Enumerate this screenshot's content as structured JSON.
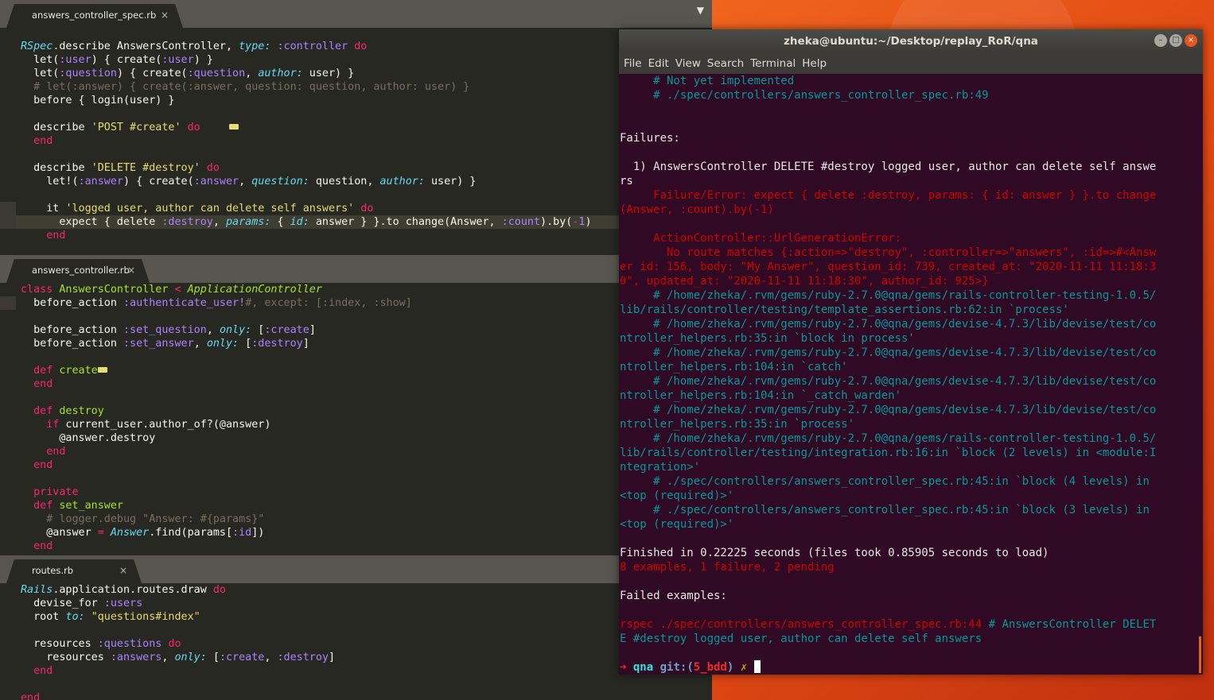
{
  "editor": {
    "pane1": {
      "tab": "answers_controller_spec.rb",
      "close": "×",
      "menu_arrow": "▼",
      "lines": [
        "RSpec.describe AnswersController, type: :controller do",
        "  let(:user) { create(:user) }",
        "  let(:question) { create(:question, author: user) }",
        "  # let(:answer) { create(:answer, question: question, author: user) }",
        "  before { login(user) }",
        "",
        "  describe 'POST #create' do",
        "  end",
        "",
        "  describe 'DELETE #destroy' do",
        "    let!(:answer) { create(:answer, question: question, author: user) }",
        "",
        "    it 'logged user, author can delete self answers' do",
        "      expect { delete :destroy, params: { id: answer } }.to change(Answer, :count).by(-1)",
        "    end"
      ]
    },
    "pane2": {
      "tab": "answers_controller.rb",
      "close": "×",
      "lines": [
        "class AnswersController < ApplicationController",
        "  before_action :authenticate_user!#, except: [:index, :show]",
        "",
        "  before_action :set_question, only: [:create]",
        "  before_action :set_answer, only: [:destroy]",
        "",
        "  def create",
        "  end",
        "",
        "  def destroy",
        "    if current_user.author_of?(@answer)",
        "      @answer.destroy",
        "    end",
        "  end",
        "",
        "  private",
        "  def set_answer",
        "    # logger.debug \"Answer: #{params}\"",
        "    @answer = Answer.find(params[:id])",
        "  end"
      ]
    },
    "pane3": {
      "tab": "routes.rb",
      "close": "×",
      "lines": [
        "Rails.application.routes.draw do",
        "  devise_for :users",
        "  root to: \"questions#index\"",
        "",
        "  resources :questions do",
        "    resources :answers, only: [:create, :destroy]",
        "  end",
        "",
        "end"
      ]
    }
  },
  "terminal": {
    "title": "zheka@ubuntu:~/Desktop/replay_RoR/qna",
    "buttons": {
      "minimize": "–",
      "maximize": "□",
      "close": "×"
    },
    "menu": [
      "File",
      "Edit",
      "View",
      "Search",
      "Terminal",
      "Help"
    ],
    "lines": [
      "     # Not yet implemented",
      "     # ./spec/controllers/answers_controller_spec.rb:49",
      "",
      "",
      "Failures:",
      "",
      "  1) AnswersController DELETE #destroy logged user, author can delete self answe",
      "rs",
      "     Failure/Error: expect { delete :destroy, params: { id: answer } }.to change",
      "(Answer, :count).by(-1)",
      "",
      "     ActionController::UrlGenerationError:",
      "       No route matches {:action=>\"destroy\", :controller=>\"answers\", :id=>#<Answ",
      "er id: 156, body: \"My Answer\", question_id: 739, created_at: \"2020-11-11 11:18:3",
      "0\", updated_at: \"2020-11-11 11:18:30\", author_id: 925>}",
      "     # /home/zheka/.rvm/gems/ruby-2.7.0@qna/gems/rails-controller-testing-1.0.5/",
      "lib/rails/controller/testing/template_assertions.rb:62:in `process'",
      "     # /home/zheka/.rvm/gems/ruby-2.7.0@qna/gems/devise-4.7.3/lib/devise/test/co",
      "ntroller_helpers.rb:35:in `block in process'",
      "     # /home/zheka/.rvm/gems/ruby-2.7.0@qna/gems/devise-4.7.3/lib/devise/test/co",
      "ntroller_helpers.rb:104:in `catch'",
      "     # /home/zheka/.rvm/gems/ruby-2.7.0@qna/gems/devise-4.7.3/lib/devise/test/co",
      "ntroller_helpers.rb:104:in `_catch_warden'",
      "     # /home/zheka/.rvm/gems/ruby-2.7.0@qna/gems/devise-4.7.3/lib/devise/test/co",
      "ntroller_helpers.rb:35:in `process'",
      "     # /home/zheka/.rvm/gems/ruby-2.7.0@qna/gems/rails-controller-testing-1.0.5/",
      "lib/rails/controller/testing/integration.rb:16:in `block (2 levels) in <module:I",
      "ntegration>'",
      "     # ./spec/controllers/answers_controller_spec.rb:45:in `block (4 levels) in",
      "<top (required)>'",
      "     # ./spec/controllers/answers_controller_spec.rb:45:in `block (3 levels) in",
      "<top (required)>'",
      "",
      "Finished in 0.22225 seconds (files took 0.85905 seconds to load)",
      "8 examples, 1 failure, 2 pending",
      "",
      "Failed examples:",
      "",
      "rspec ./spec/controllers/answers_controller_spec.rb:44 # AnswersController DELET",
      "E #destroy logged user, author can delete self answers",
      ""
    ],
    "prompt": {
      "arrow": "➜",
      "dir": "qna",
      "git_open": "git:(",
      "branch": "5_bdd",
      "git_close": ")",
      "dirty": "✗"
    }
  }
}
